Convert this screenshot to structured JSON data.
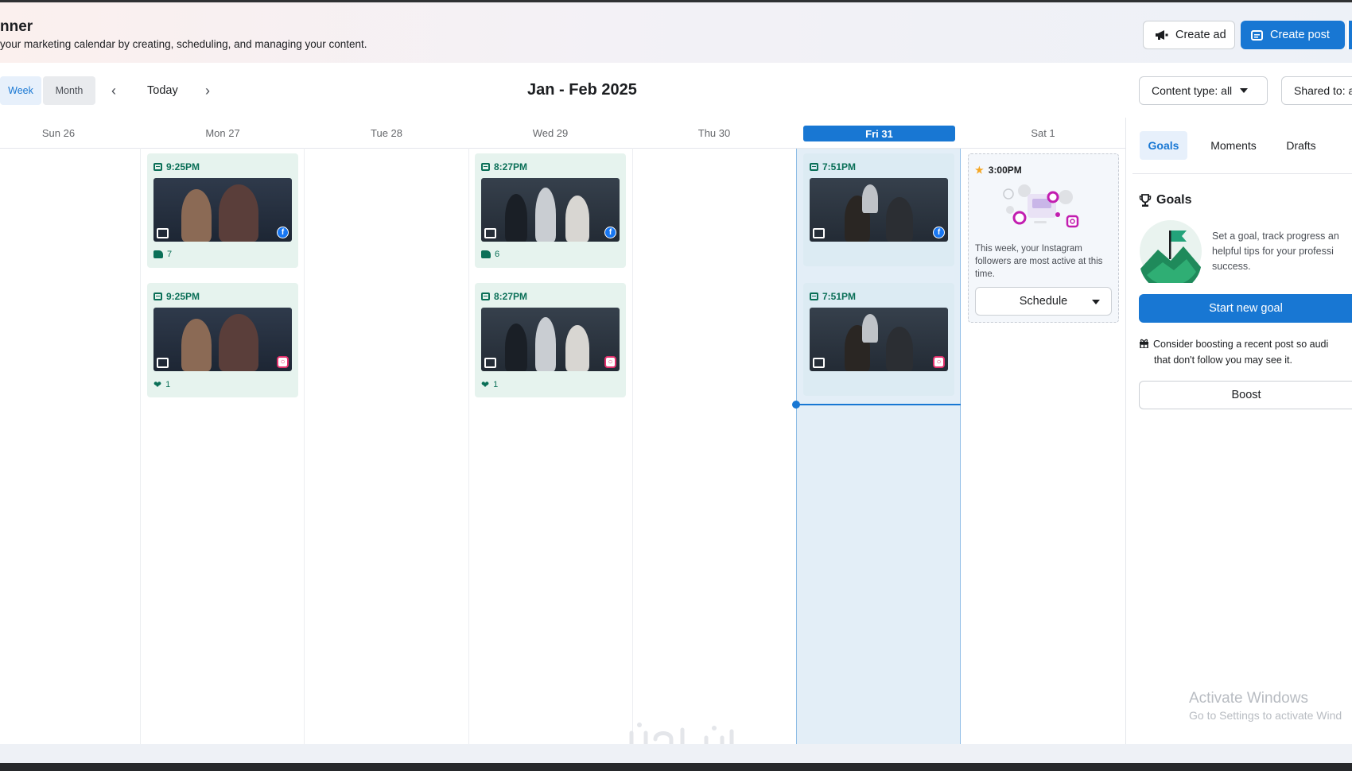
{
  "header": {
    "title": "nner",
    "subtitle": "your marketing calendar by creating, scheduling, and managing your content.",
    "create_ad_label": "Create ad",
    "create_post_label": "Create post"
  },
  "toolbar": {
    "week_label": "Week",
    "month_label": "Month",
    "today_label": "Today",
    "range_label": "Jan - Feb 2025",
    "content_type_label": "Content type: all",
    "shared_to_label": "Shared to: a"
  },
  "days": [
    "Sun 26",
    "Mon 27",
    "Tue 28",
    "Wed 29",
    "Thu 30",
    "Fri 31",
    "Sat 1"
  ],
  "posts": [
    {
      "time": "9:25PM",
      "metric": "7",
      "platform": "facebook"
    },
    {
      "time": "9:25PM",
      "metric": "1",
      "platform": "instagram"
    },
    {
      "time": "8:27PM",
      "metric": "6",
      "platform": "facebook"
    },
    {
      "time": "8:27PM",
      "metric": "1",
      "platform": "instagram"
    },
    {
      "time": "7:51PM",
      "platform": "facebook"
    },
    {
      "time": "7:51PM",
      "platform": "instagram"
    }
  ],
  "best_time": {
    "time": "3:00PM",
    "text": "This week, your Instagram followers are most active at this time.",
    "schedule_label": "Schedule"
  },
  "panel": {
    "tabs": [
      "Goals",
      "Moments",
      "Drafts"
    ],
    "goals_title": "Goals",
    "goals_desc_1": "Set a goal, track progress an",
    "goals_desc_2": "helpful tips for your professi",
    "goals_desc_3": "success.",
    "start_goal_label": "Start new goal",
    "boost_tip_1": "Consider boosting a recent post so audi",
    "boost_tip_2": "that don't follow you may see it.",
    "boost_label": "Boost"
  },
  "watermark": {
    "title": "Activate Windows",
    "subtitle": "Go to Settings to activate Wind"
  },
  "colors": {
    "accent": "#1877d3",
    "post_bg": "#e6f3ee",
    "post_text": "#0a6f57",
    "today_column": "#e3eef7"
  }
}
